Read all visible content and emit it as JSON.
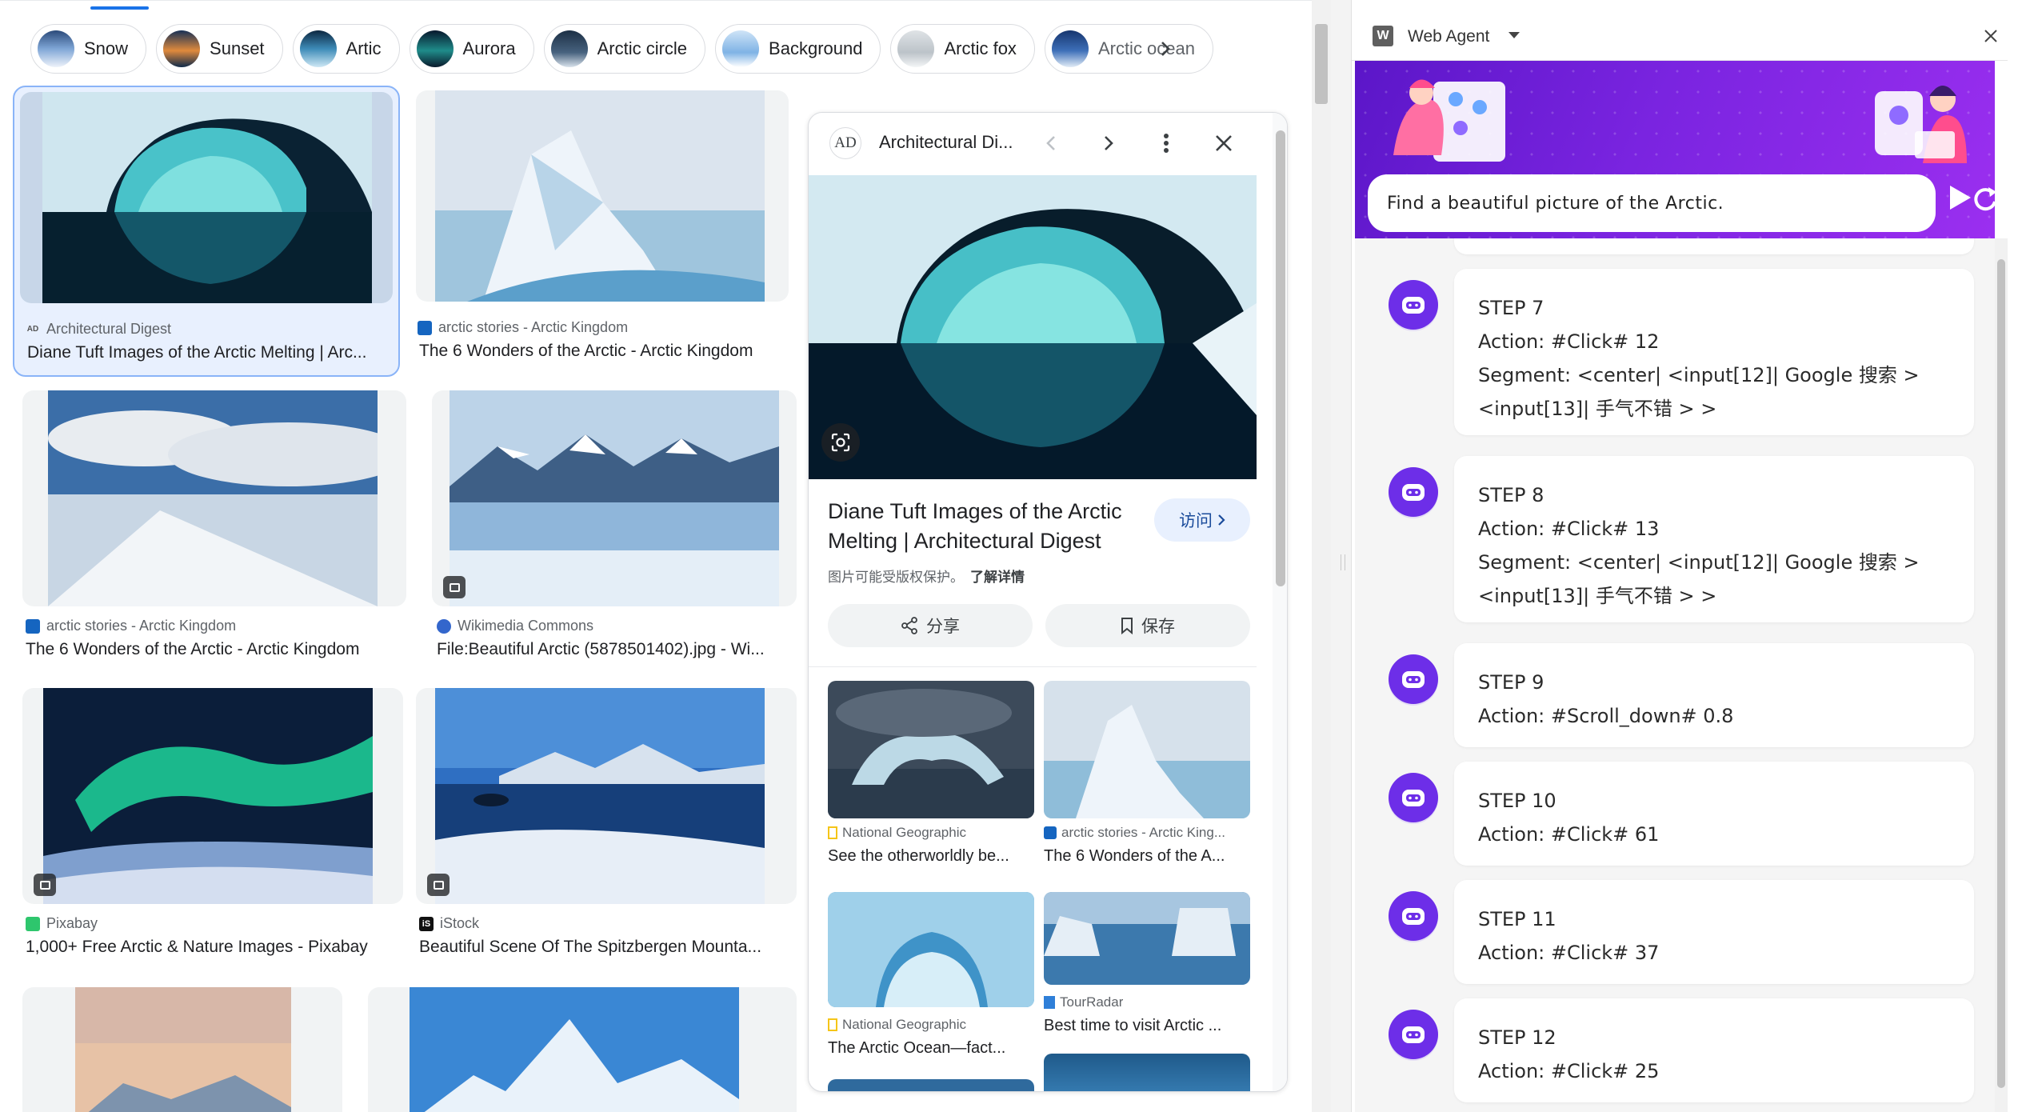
{
  "chips": [
    {
      "label": "Snow",
      "thumb": "linear-gradient(180deg,#2b4a7a 0%,#7fa6d6 50%,#eef3fa 100%)"
    },
    {
      "label": "Sunset",
      "thumb": "linear-gradient(180deg,#173056 0%,#e08a3c 55%,#0f2a4a 100%)"
    },
    {
      "label": "Artic",
      "thumb": "linear-gradient(180deg,#0d2740 0%,#3d8bb8 50%,#cfe8f5 100%)"
    },
    {
      "label": "Aurora",
      "thumb": "linear-gradient(180deg,#07172c 0%,#1f8c8a 55%,#0a1a2c 100%)"
    },
    {
      "label": "Arctic circle",
      "thumb": "linear-gradient(180deg,#1c2f45 0%,#47627e 60%,#d9e3ec 100%)"
    },
    {
      "label": "Background",
      "thumb": "linear-gradient(180deg,#cfe4f7 0%,#7fb3e5 60%,#ffffff 100%)"
    },
    {
      "label": "Arctic fox",
      "thumb": "linear-gradient(180deg,#dfe3e6 0%,#bcc3c9 60%,#f4f6f7 100%)"
    },
    {
      "label": "Arctic ocean",
      "thumb": "linear-gradient(180deg,#16356e 0%,#3d6fb8 55%,#e2ecf7 100%)"
    }
  ],
  "results": [
    {
      "source": "Architectural Digest",
      "title": "Diane Tuft Images of the Arctic Melting | Arc...",
      "fav": "AD",
      "fav_color": "#ffffff"
    },
    {
      "source": "arctic stories - Arctic Kingdom",
      "title": "The 6 Wonders of the Arctic - Arctic Kingdom",
      "fav": "",
      "fav_color": "#1565c0"
    },
    {
      "source": "arctic stories - Arctic Kingdom",
      "title": "The 6 Wonders of the Arctic - Arctic Kingdom",
      "fav": "",
      "fav_color": "#1565c0"
    },
    {
      "source": "Wikimedia Commons",
      "title": "File:Beautiful Arctic (5878501402).jpg - Wi...",
      "fav": "",
      "fav_color": "#3366cc"
    },
    {
      "source": "Pixabay",
      "title": "1,000+ Free Arctic & Nature Images - Pixabay",
      "fav": "",
      "fav_color": "#2ec66d"
    },
    {
      "source": "iStock",
      "title": "Beautiful Scene Of The Spitzbergen Mounta...",
      "fav": "iS",
      "fav_color": "#111111"
    }
  ],
  "preview": {
    "site": "Architectural Di...",
    "logo": "AD",
    "title": "Diane Tuft Images of the Arctic Melting | Architectural Digest",
    "visit": "访问",
    "copyright": "图片可能受版权保护。",
    "learn_more": "了解详情",
    "share": "分享",
    "save": "保存",
    "related": [
      {
        "source": "National Geographic",
        "title": "See the otherworldly be...",
        "fav_color": "#f5c518"
      },
      {
        "source": "arctic stories - Arctic King...",
        "title": "The 6 Wonders of the A...",
        "fav_color": "#1565c0"
      },
      {
        "source": "National Geographic",
        "title": "The Arctic Ocean—fact...",
        "fav_color": "#f5c518"
      },
      {
        "source": "TourRadar",
        "title": "Best time to visit Arctic ...",
        "fav_color": "#2f7fd8"
      }
    ]
  },
  "agent": {
    "title": "Web Agent",
    "logo": "W",
    "query": "Find a beautiful picture of the Arctic.",
    "steps": [
      {
        "lines": [
          "STEP 7",
          "Action: #Click# 12",
          "Segment: <center| <input[12]| Google 搜索 >",
          "<input[13]| 手气不错 > >"
        ]
      },
      {
        "lines": [
          "STEP 8",
          "Action: #Click# 13",
          "Segment: <center| <input[12]| Google 搜索 >",
          "<input[13]| 手气不错 > >"
        ]
      },
      {
        "lines": [
          "STEP 9",
          "Action: #Scroll_down# 0.8"
        ]
      },
      {
        "lines": [
          "STEP 10",
          "Action: #Click# 61"
        ]
      },
      {
        "lines": [
          "STEP 11",
          "Action: #Click# 37"
        ]
      },
      {
        "lines": [
          "STEP 12",
          "Action: #Click# 25"
        ]
      }
    ]
  },
  "colors": {
    "accent": "#1a73e8",
    "agent_purple": "#6d2ee8",
    "banner": "#7a24e0"
  },
  "icons": [
    "chevron-right-icon",
    "chevron-left-icon",
    "more-vert-icon",
    "close-icon",
    "lens-icon",
    "share-icon",
    "bookmark-icon",
    "send-icon",
    "refresh-icon",
    "robot-icon",
    "caret-down-icon"
  ]
}
